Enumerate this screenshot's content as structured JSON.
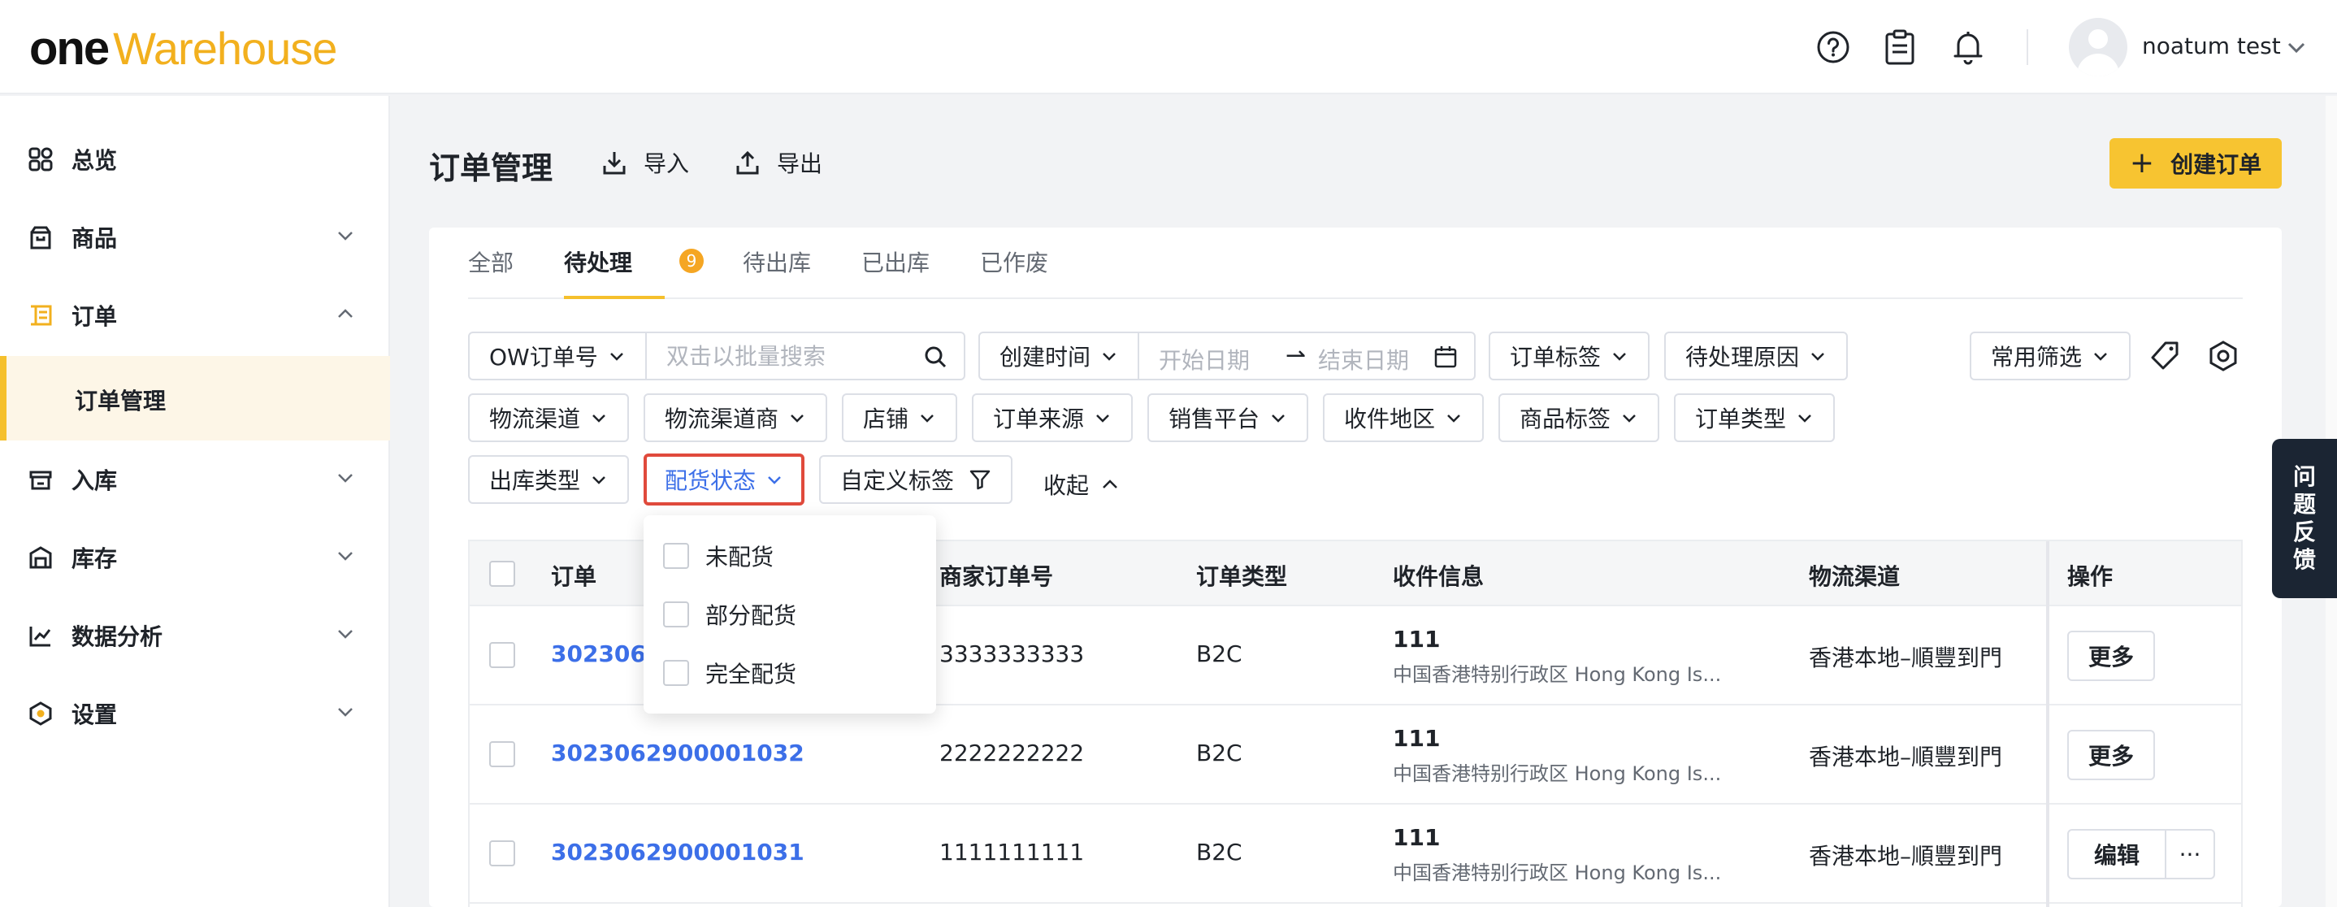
{
  "brand": {
    "one": "one",
    "warehouse": "Warehouse"
  },
  "topbar": {
    "username": "noatum test",
    "icons": [
      "help-circle-icon",
      "clipboard-icon",
      "bell-icon"
    ]
  },
  "sidebar": {
    "items": [
      {
        "label": "总览",
        "icon": "dashboard-grid-icon"
      },
      {
        "label": "商品",
        "icon": "product-bag-icon"
      },
      {
        "label": "订单",
        "icon": "order-list-icon"
      },
      {
        "label": "订单管理"
      },
      {
        "label": "入库",
        "icon": "inbound-icon"
      },
      {
        "label": "库存",
        "icon": "inventory-icon"
      },
      {
        "label": "数据分析",
        "icon": "analytics-icon"
      },
      {
        "label": "设置",
        "icon": "settings-hex-icon"
      }
    ]
  },
  "header": {
    "title": "订单管理",
    "import_label": "导入",
    "export_label": "导出",
    "create_label": "创建订单"
  },
  "tabs": [
    {
      "label": "全部"
    },
    {
      "label": "待处理",
      "badge": "9"
    },
    {
      "label": "待出库"
    },
    {
      "label": "已出库"
    },
    {
      "label": "已作废"
    }
  ],
  "filters": {
    "search_field": "OW订单号",
    "search_placeholder": "双击以批量搜索",
    "date_field": "创建时间",
    "date_start": "开始日期",
    "date_end": "结束日期",
    "chips": [
      "订单标签",
      "待处理原因",
      "常用筛选",
      "物流渠道",
      "物流渠道商",
      "店铺",
      "订单来源",
      "销售平台",
      "收件地区",
      "商品标签",
      "订单类型",
      "出库类型",
      "配货状态",
      "自定义标签"
    ],
    "collapse_label": "收起"
  },
  "allocation_dropdown": {
    "options": [
      "未配货",
      "部分配货",
      "完全配货"
    ]
  },
  "table": {
    "headers": [
      "订单",
      "商家订单号",
      "订单类型",
      "收件信息",
      "物流渠道",
      "操作"
    ],
    "rows": [
      {
        "order": "30230629",
        "merchant_no": "3333333333",
        "type": "B2C",
        "recipient": "111",
        "address": "中国香港特别行政区 Hong Kong Is...",
        "channel": "香港本地–順豐到門",
        "action": "更多"
      },
      {
        "order": "3023062900001032",
        "merchant_no": "2222222222",
        "type": "B2C",
        "recipient": "111",
        "address": "中国香港特别行政区 Hong Kong Is...",
        "channel": "香港本地–順豐到門",
        "action": "更多"
      },
      {
        "order": "3023062900001031",
        "merchant_no": "1111111111",
        "type": "B2C",
        "recipient": "111",
        "address": "中国香港特别行政区 Hong Kong Is...",
        "channel": "香港本地–順豐到門",
        "action": "编辑",
        "more": "···"
      }
    ]
  },
  "feedback": {
    "chars": [
      "问",
      "题",
      "反",
      "馈"
    ]
  },
  "colors": {
    "accent": "#f7c431",
    "link": "#3c6fe8",
    "highlight_border": "#e04a3c"
  }
}
